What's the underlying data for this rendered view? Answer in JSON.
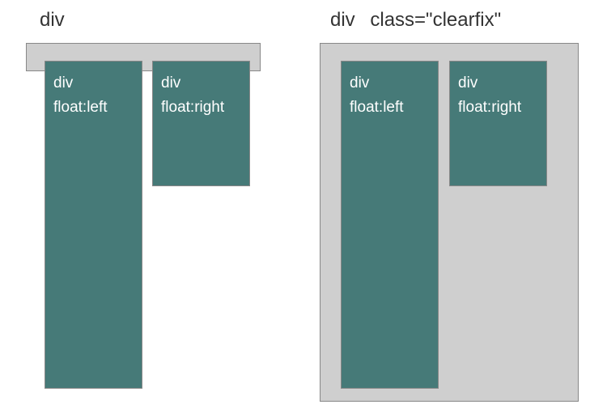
{
  "left": {
    "title": "div",
    "boxA": {
      "line1": "div",
      "line2": "float:left"
    },
    "boxB": {
      "line1": "div",
      "line2": "float:right"
    }
  },
  "right": {
    "title1": "div",
    "title2": "class=\"clearfix\"",
    "boxA": {
      "line1": "div",
      "line2": "float:left"
    },
    "boxB": {
      "line1": "div",
      "line2": "float:right"
    }
  }
}
